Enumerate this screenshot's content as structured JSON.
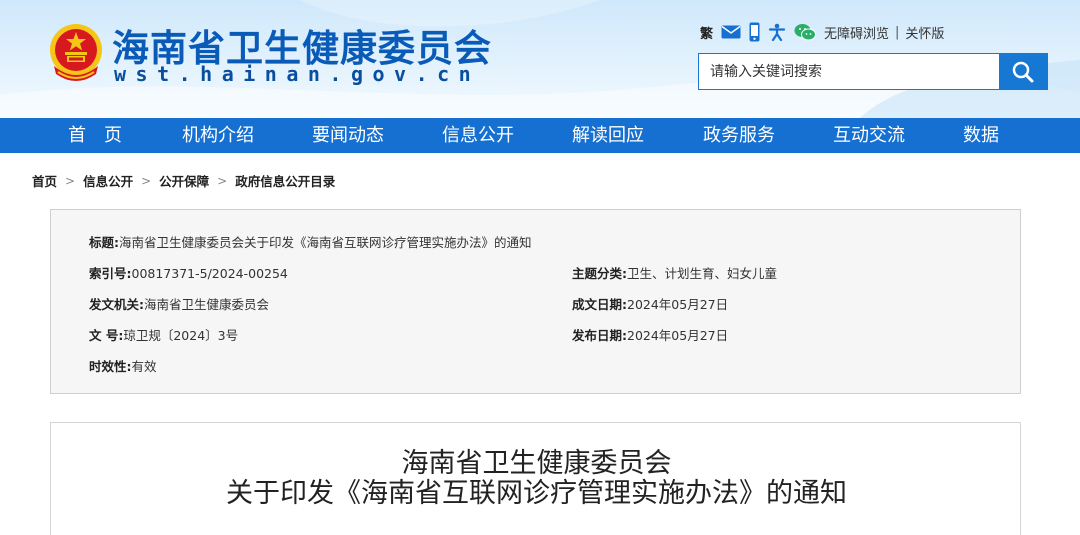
{
  "header": {
    "site_title": "海南省卫生健康委员会",
    "site_domain": "wst.hainan.gov.cn",
    "tools": {
      "traditional": "繁",
      "mail_icon": "mail-icon",
      "phone_icon": "mobile-phone-icon",
      "accessibility_icon": "accessibility-icon",
      "wechat_icon": "wechat-icon",
      "barrier_free": "无障碍浏览",
      "separator": "|",
      "care_version": "关怀版"
    },
    "search": {
      "placeholder": "请输入关键词搜索",
      "button_icon": "search-icon"
    }
  },
  "nav": {
    "items": [
      {
        "label": "首　页"
      },
      {
        "label": "机构介绍"
      },
      {
        "label": "要闻动态"
      },
      {
        "label": "信息公开"
      },
      {
        "label": "解读回应"
      },
      {
        "label": "政务服务"
      },
      {
        "label": "互动交流"
      },
      {
        "label": "数据"
      }
    ]
  },
  "breadcrumb": {
    "items": [
      "首页",
      "信息公开",
      "公开保障",
      "政府信息公开目录"
    ],
    "separator": ">"
  },
  "info": {
    "title_label": "标题:",
    "title_value": "海南省卫生健康委员会关于印发《海南省互联网诊疗管理实施办法》的通知",
    "index_label": "索引号:",
    "index_value": "00817371-5/2024-00254",
    "topic_label": "主题分类:",
    "topic_value": "卫生、计划生育、妇女儿童",
    "issuer_label": "发文机关:",
    "issuer_value": "海南省卫生健康委员会",
    "written_label": "成文日期:",
    "written_value": "2024年05月27日",
    "docno_label": "文 号:",
    "docno_value": "琼卫规〔2024〕3号",
    "published_label": "发布日期:",
    "published_value": "2024年05月27日",
    "validity_label": "时效性:",
    "validity_value": "有效"
  },
  "document": {
    "title_line1": "海南省卫生健康委员会",
    "title_line2": "关于印发《海南省互联网诊疗管理实施办法》的通知"
  },
  "colors": {
    "brand_blue": "#1670d1",
    "title_blue": "#0a5bb8",
    "emblem_red": "#d7191f",
    "emblem_gold": "#f5c518"
  }
}
